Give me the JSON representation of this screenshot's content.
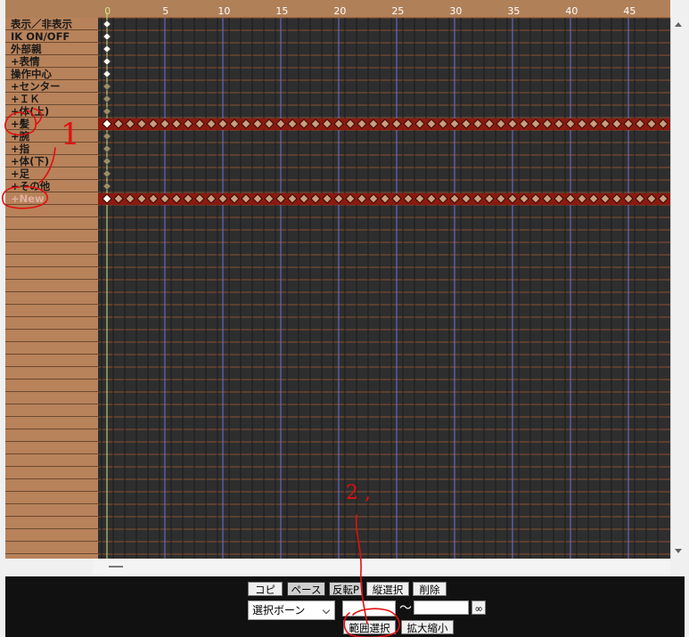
{
  "timeline": {
    "ticks": [
      "0",
      "5",
      "10",
      "15",
      "20",
      "25",
      "30",
      "35",
      "40",
      "45"
    ],
    "current_frame": "0",
    "bones": [
      {
        "label": "表示／非表示",
        "kind": "plain"
      },
      {
        "label": "IK ON/OFF",
        "kind": "plain"
      },
      {
        "label": "外部親",
        "kind": "plain"
      },
      {
        "label": "+表情",
        "kind": "group"
      },
      {
        "label": "操作中心",
        "kind": "plain"
      },
      {
        "label": "+センター",
        "kind": "group"
      },
      {
        "label": "+ＩＫ",
        "kind": "group"
      },
      {
        "label": "+体(上)",
        "kind": "group"
      },
      {
        "label": "+髪",
        "kind": "group"
      },
      {
        "label": "+腕",
        "kind": "group"
      },
      {
        "label": "+指",
        "kind": "group"
      },
      {
        "label": "+体(下)",
        "kind": "group"
      },
      {
        "label": "+足",
        "kind": "group"
      },
      {
        "label": "+その他",
        "kind": "group"
      },
      {
        "label": "+New",
        "kind": "new"
      }
    ],
    "selected_rows": [
      8,
      14
    ],
    "keyframe_color_frame0": "#fffff0",
    "selected_row_color": "#8b1a10"
  },
  "controls": {
    "copy": "コピー",
    "paste": "ペースト",
    "reverse_paste": "反転P",
    "vertical_select": "縦選択",
    "delete": "削除",
    "bone_select": "選択ボーン",
    "range_from": "",
    "tilde": "〜",
    "range_to": "",
    "infinity": "∞",
    "range_select": "範囲選択",
    "scale": "拡大縮小"
  },
  "annotations": {
    "mark_1": "1",
    "mark_2": "2 ,"
  }
}
